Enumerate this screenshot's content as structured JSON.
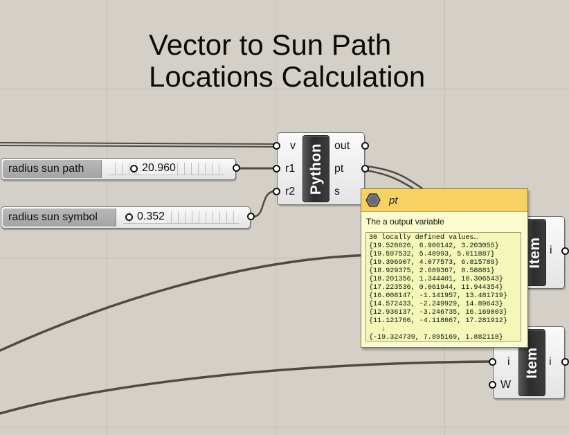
{
  "title": {
    "line1": "Vector to Sun Path",
    "line2": "Locations Calculation"
  },
  "sliders": [
    {
      "label": "radius sun path",
      "value": "20.960"
    },
    {
      "label": "radius sun symbol",
      "value": "0.352"
    }
  ],
  "python_component": {
    "name": "Python",
    "inputs": [
      "v",
      "r1",
      "r2"
    ],
    "outputs": [
      "out",
      "pt",
      "s"
    ]
  },
  "item_component_top": {
    "name": "Item",
    "outputs": [
      "i"
    ]
  },
  "item_component_bottom": {
    "name": "Item",
    "inputs": [
      "i",
      "W"
    ],
    "outputs": [
      "i"
    ]
  },
  "tooltip": {
    "icon": "hexagon-param-icon",
    "title": "pt",
    "description": "The a output variable",
    "header": "30 locally defined values…",
    "values": [
      "{19.528626, 6.906142, 3.203055}",
      "{19.597532, 5.48993, 5.011887}",
      "{19.396907, 4.077573, 6.815789}",
      "{18.929375, 2.689367, 8.58881}",
      "{18.201356, 1.344401, 10.306543}",
      "{17.223536, 0.061944, 11.944354}",
      "{16.008147, -1.141957, 13.481719}",
      "{14.572433, -2.249929, 14.89643}",
      "{12.936137, -3.246735, 16.169003}",
      "{11.121766, -4.118667, 17.281912}"
    ],
    "ellipsis": "↓",
    "last_value": "{-19.324739, 7.895169, 1.882118}"
  },
  "colors": {
    "canvas": "#d4d0c8",
    "tooltip_header": "#f7d263",
    "tooltip_body": "#fbfbd0",
    "data_box": "#f3f7b8",
    "wire": "#4f4a44"
  }
}
